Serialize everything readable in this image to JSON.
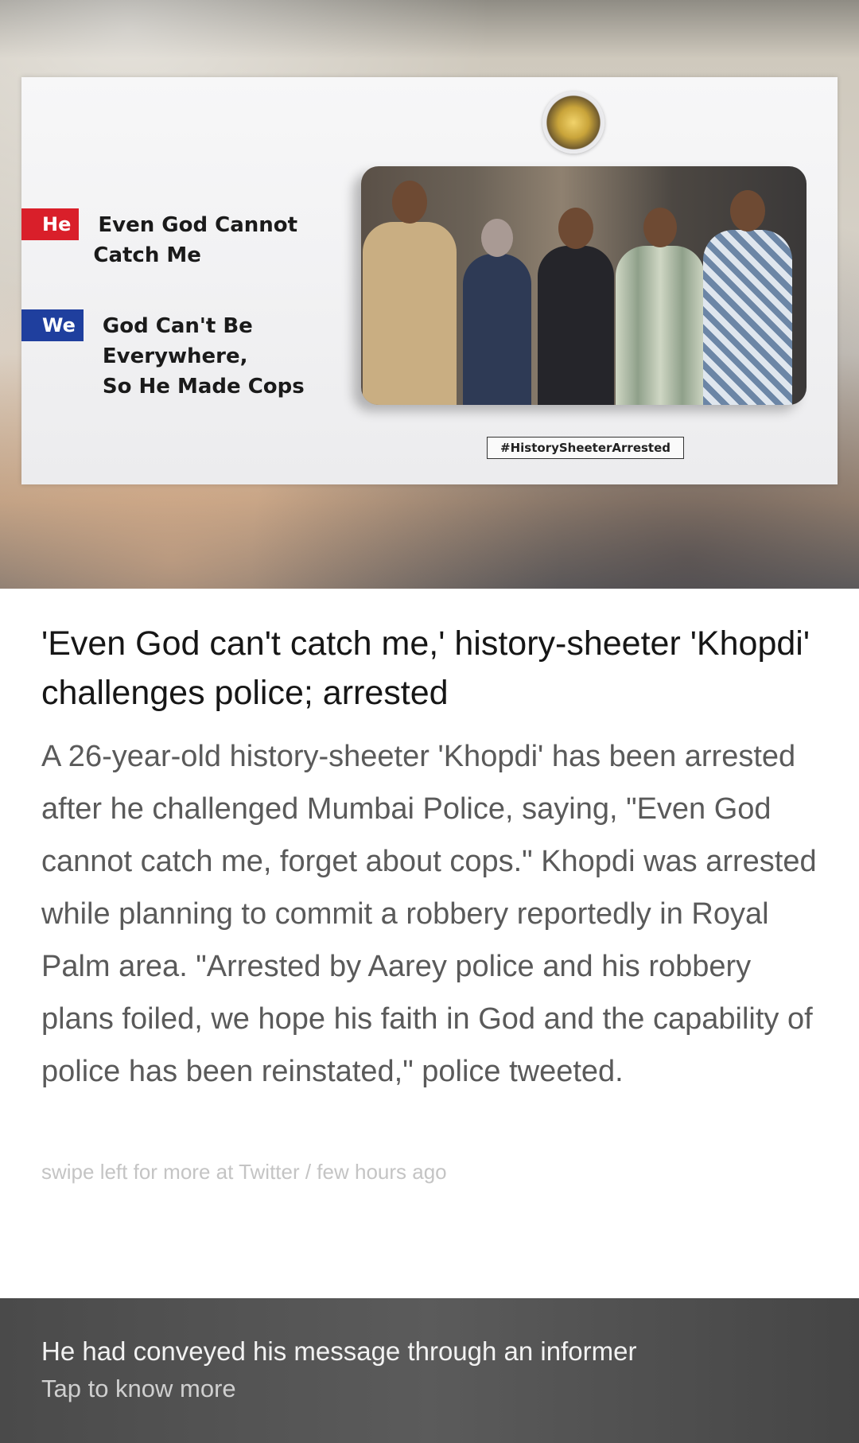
{
  "hero": {
    "tweet": {
      "he_tag": "He",
      "he_text_line1": "Even God Cannot",
      "he_text_line2": "Catch Me",
      "we_tag": "We",
      "we_text_line1": "God Can't Be",
      "we_text_line2": "Everywhere,",
      "we_text_line3": "So He Made Cops",
      "hashtag": "#HistorySheeterArrested"
    }
  },
  "article": {
    "headline": "'Even God can't catch me,' history-sheeter 'Khopdi' challenges police; arrested",
    "body": "A 26-year-old history-sheeter 'Khopdi' has been arrested after he challenged Mumbai Police, saying, \"Even God cannot catch me, forget about cops.\" Khopdi was arrested while planning to commit a robbery reportedly in Royal Palm area. \"Arrested by Aarey police and his robbery plans foiled, we hope his faith in God and the capability of police has been reinstated,\" police tweeted.",
    "meta": "swipe left for more at Twitter / few hours ago"
  },
  "footer": {
    "title": "He had conveyed his message through an informer",
    "subtitle": "Tap to know more"
  }
}
